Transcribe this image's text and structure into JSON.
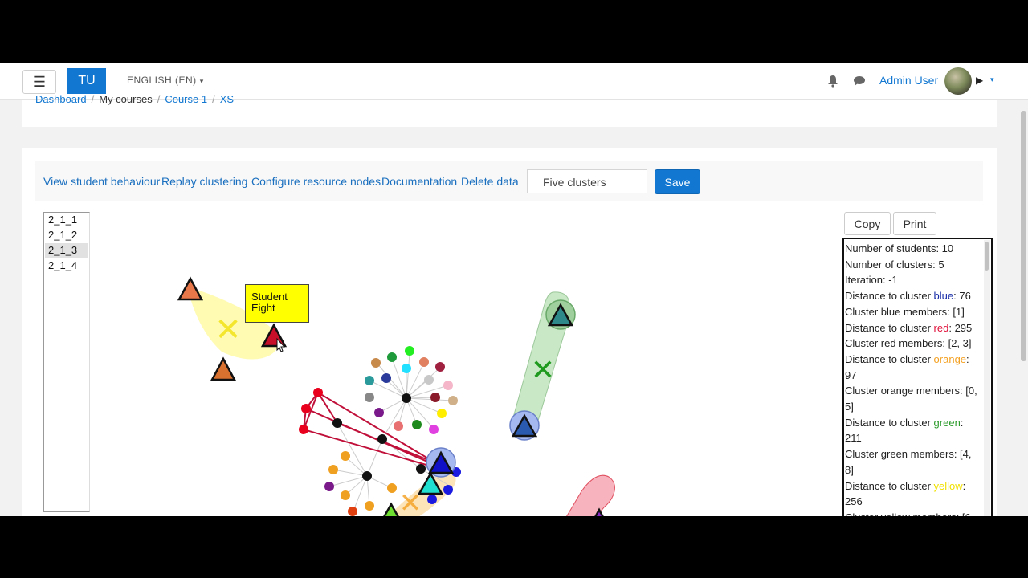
{
  "navbar": {
    "logo": "TU",
    "language": "ENGLISH (EN)",
    "user_name": "Admin User"
  },
  "breadcrumb": [
    "Dashboard",
    "My courses",
    "Course 1",
    "XS"
  ],
  "toolbar": {
    "links": [
      "View student behaviour",
      "Replay clustering",
      "Configure resource nodes",
      "Documentation",
      "Delete data"
    ],
    "cluster_select": "Five clusters",
    "save_label": "Save"
  },
  "node_list": [
    "2_1_1",
    "2_1_2",
    "2_1_3",
    "2_1_4"
  ],
  "selected_node": "2_1_3",
  "actions": {
    "copy_label": "Copy",
    "print_label": "Print"
  },
  "tooltip": {
    "line1": "Student",
    "line2": "Eight"
  },
  "info_panel": {
    "students": "Number of students: 10",
    "clusters": "Number of clusters: 5",
    "iteration": "Iteration: -1",
    "blue_prefix": "Distance to cluster ",
    "blue_name": "blue",
    "blue_value": ": 76",
    "blue_members": "Cluster blue members: [1]",
    "red_prefix": "Distance to cluster ",
    "red_name": "red",
    "red_value": ": 295",
    "red_members": "Cluster red members: [2, 3]",
    "orange_prefix": "Distance to cluster ",
    "orange_name": "orange",
    "orange_value": ": 97",
    "orange_members": "Cluster orange members: [0, 5]",
    "green_prefix": "Distance to cluster ",
    "green_name": "green",
    "green_value": ": 211",
    "green_members": "Cluster green members: [4, 8]",
    "yellow_prefix": "Distance to cluster ",
    "yellow_name": "yellow",
    "yellow_value": ": 256",
    "yellow_members": "Cluster yellow members: [6"
  },
  "colors": {
    "accent": "#1177d1",
    "blue": "#1a2ea8",
    "red": "#e0103a",
    "orange": "#f4a020",
    "green": "#2a9a2a",
    "yellow": "#f0e000"
  }
}
